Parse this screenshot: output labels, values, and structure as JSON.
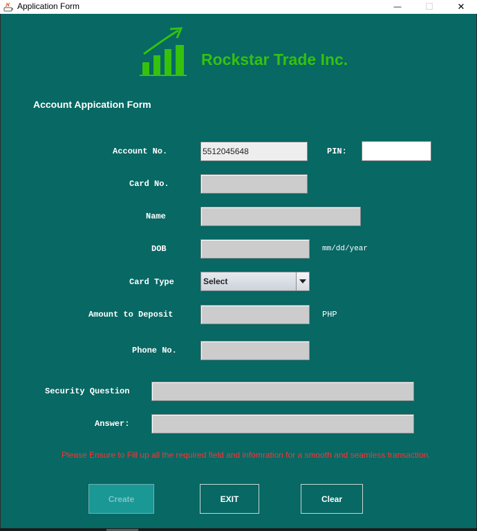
{
  "window": {
    "title": "Application Form",
    "minimize_glyph": "—",
    "maximize_glyph": "☐",
    "close_glyph": "✕"
  },
  "header": {
    "company_name": "Rockstar Trade Inc.",
    "logo_icon": "growth-chart-icon",
    "brand_color": "#35c10e"
  },
  "form": {
    "title": "Account Appication Form",
    "account_no_label": "Account No.",
    "account_no_value": "5512045648",
    "pin_label": "PIN:",
    "pin_value": "",
    "card_no_label": "Card No.",
    "card_no_value": "",
    "name_label": "Name",
    "name_value": "",
    "dob_label": "DOB",
    "dob_value": "",
    "dob_hint": "mm/dd/year",
    "card_type_label": "Card Type",
    "card_type_selected": "Select",
    "amount_label": "Amount to Deposit",
    "amount_value": "",
    "currency": "PHP",
    "phone_label": "Phone No.",
    "phone_value": "",
    "security_question_label": "Security Question",
    "security_question_value": "",
    "answer_label": "Answer:",
    "answer_value": ""
  },
  "warning": "Please Ensure to Fill up all the required field and infomration for a smooth and seamless transaction.",
  "buttons": {
    "create": "Create",
    "exit": "EXIT",
    "clear": "Clear"
  },
  "colors": {
    "background": "#076864",
    "warning": "#ff3333",
    "field": "#cccccc"
  }
}
